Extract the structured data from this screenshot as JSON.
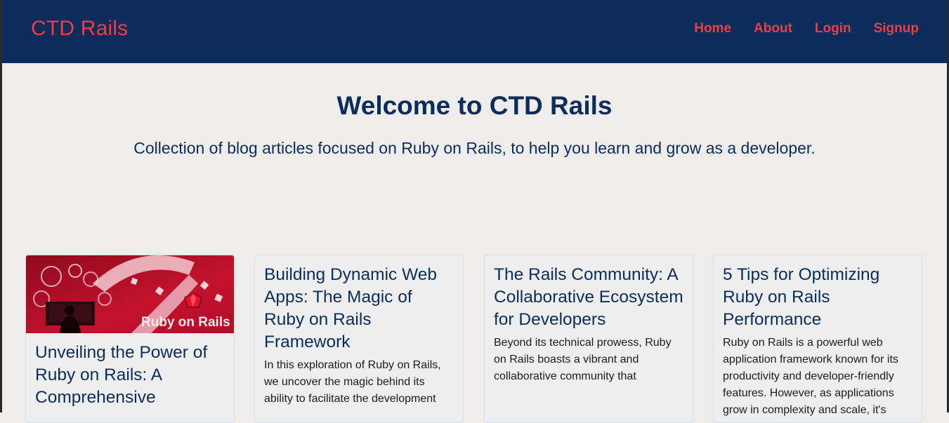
{
  "navbar": {
    "brand": "CTD Rails",
    "links": [
      "Home",
      "About",
      "Login",
      "Signup"
    ]
  },
  "hero": {
    "title": "Welcome to CTD Rails",
    "subtitle": "Collection of blog articles focused on Ruby on Rails, to help you learn and grow as a developer."
  },
  "articles": [
    {
      "image_caption": "Ruby on Rails",
      "title": "Unveiling the Power of Ruby on Rails: A Comprehensive",
      "excerpt": ""
    },
    {
      "title": "Building Dynamic Web Apps: The Magic of Ruby on Rails Framework",
      "excerpt": "In this exploration of Ruby on Rails, we uncover the magic behind its ability to facilitate the development"
    },
    {
      "title": "The Rails Community: A Collaborative Ecosystem for Developers",
      "excerpt": "Beyond its technical prowess, Ruby on Rails boasts a vibrant and collaborative community that"
    },
    {
      "title": "5 Tips for Optimizing Ruby on Rails Performance",
      "excerpt": "Ruby on Rails is a powerful web application framework known for its productivity and developer-friendly features. However, as applications grow in complexity and scale, it's"
    }
  ],
  "colors": {
    "navbar_bg": "#0c2d5b",
    "accent": "#f03c42",
    "page_bg": "#efedec",
    "heading": "#0c2d5b"
  }
}
